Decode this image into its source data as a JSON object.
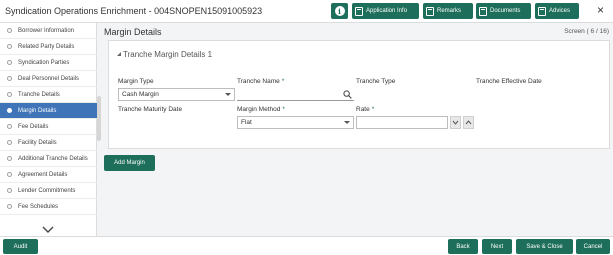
{
  "header": {
    "title": "Syndication Operations Enrichment - 004SNOPEN15091005923",
    "buttons": [
      "Application Info",
      "Remarks",
      "Documents",
      "Advices"
    ],
    "info_glyph": "i",
    "close_glyph": "×"
  },
  "sidebar": {
    "items": [
      {
        "label": "Borrower Information"
      },
      {
        "label": "Related Party Details"
      },
      {
        "label": "Syndication Parties"
      },
      {
        "label": "Deal Personnel Details"
      },
      {
        "label": "Tranche Details"
      },
      {
        "label": "Margin Details"
      },
      {
        "label": "Fee Details"
      },
      {
        "label": "Facility Details"
      },
      {
        "label": "Additional Tranche Details"
      },
      {
        "label": "Agreement Details"
      },
      {
        "label": "Lender Commitments"
      },
      {
        "label": "Fee Schedules"
      }
    ],
    "active_index": 5
  },
  "main": {
    "page_title": "Margin Details",
    "screen_indicator": "Screen ( 6 / 16)",
    "section_title": "Tranche Margin Details 1",
    "fields": {
      "margin_type": {
        "label": "Margin Type",
        "value": "Cash Margin"
      },
      "tranche_name": {
        "label": "Tranche Name",
        "required": "*",
        "value": ""
      },
      "tranche_type": {
        "label": "Tranche Type",
        "value": ""
      },
      "tranche_effective_date": {
        "label": "Tranche Effective Date",
        "value": ""
      },
      "tranche_maturity_date": {
        "label": "Tranche Maturity Date",
        "value": ""
      },
      "margin_method": {
        "label": "Margin Method",
        "required": "*",
        "value": "Flat"
      },
      "rate": {
        "label": "Rate",
        "required": "*",
        "value": ""
      }
    },
    "add_margin_label": "Add Margin"
  },
  "footer": {
    "audit": "Audit",
    "back": "Back",
    "next": "Next",
    "save_close": "Save & Close",
    "cancel": "Cancel"
  },
  "colors": {
    "primary": "#1d6e5a",
    "active_nav": "#3f74b8"
  }
}
